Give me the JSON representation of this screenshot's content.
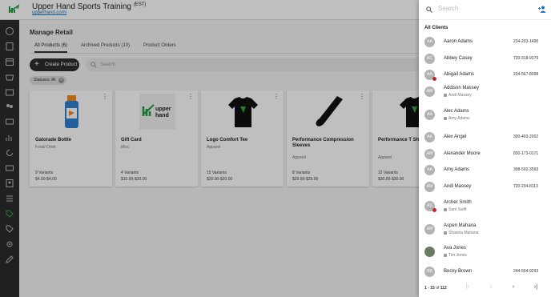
{
  "header": {
    "business_name": "Upper Hand Sports Training",
    "timezone": "(EST)",
    "url": "upperhand.com/"
  },
  "sidebar": {
    "icons": [
      "dashboard-icon",
      "book-icon",
      "calendar-icon",
      "store-icon",
      "wallet-icon",
      "people-icon",
      "chat-icon",
      "report-icon",
      "refresh-icon",
      "ticket-icon",
      "contacts-icon",
      "list-icon",
      "tag-icon",
      "discount-icon",
      "settings-icon",
      "edit-icon"
    ]
  },
  "main": {
    "title": "Manage Retail",
    "tabs": [
      {
        "label": "All Products (6)"
      },
      {
        "label": "Archived Products (10)"
      },
      {
        "label": "Product Orders"
      }
    ],
    "create_label": "Create Product",
    "search_placeholder": "Search",
    "filter_chip": "Statuses: All",
    "products": [
      {
        "name": "Gatorade Bottle",
        "category": "Food/ Drink",
        "variants": "9 Variants",
        "price": "$4.00-$4.00"
      },
      {
        "name": "Gift Card",
        "category": "Misc",
        "variants": "4 Variants",
        "price": "$10.00-$30.00"
      },
      {
        "name": "Logo Comfort Tee",
        "category": "Apparel",
        "variants": "15 Variants",
        "price": "$20.00-$20.00"
      },
      {
        "name": "Performance Compression Sleeves",
        "category": "Apparel",
        "variants": "8 Variants",
        "price": "$29.99-$29.99"
      },
      {
        "name": "Performance T Sh Sleeve",
        "category": "Apparel",
        "variants": "12 Variants",
        "price": "$30.00-$30.00"
      }
    ],
    "gift_card_logo_text": "upper hand"
  },
  "drawer": {
    "search_placeholder": "Search",
    "heading": "All Clients",
    "clients": [
      {
        "initials": "AA",
        "name": "Aaron Adams",
        "phone": "234-203-1490"
      },
      {
        "initials": "AC",
        "name": "Abbey Casey",
        "phone": "720-318-9379"
      },
      {
        "initials": "AA",
        "name": "Abigail Adams",
        "phone": "234-567-8098",
        "alert": true
      },
      {
        "initials": "AM",
        "name": "Addison Massey",
        "phone": "",
        "managed_by": "Andi Massey"
      },
      {
        "initials": "AA",
        "name": "Alec Adams",
        "phone": "",
        "managed_by": "Amy Adams"
      },
      {
        "initials": "AA",
        "name": "Alex Angel",
        "phone": "390-493-2002"
      },
      {
        "initials": "AM",
        "name": "Alexander Moore",
        "phone": "830-173-0171"
      },
      {
        "initials": "AA",
        "name": "Amy Adams",
        "phone": "398-592-3593"
      },
      {
        "initials": "AM",
        "name": "Andi Massey",
        "phone": "720-234-8113"
      },
      {
        "initials": "AS",
        "name": "Archer Smith",
        "phone": "",
        "managed_by": "Sam Swift",
        "alert": true
      },
      {
        "initials": "AM",
        "name": "Aspen Mahana",
        "phone": "",
        "managed_by": "Shawna Mahana"
      },
      {
        "initials": "",
        "name": "Ava Jones",
        "phone": "",
        "managed_by": "Tim Jones",
        "photo": true
      },
      {
        "initials": "BB",
        "name": "Becky Brown",
        "phone": "244-564-9293"
      }
    ],
    "pagination": {
      "range": "1 - 15",
      "of": "of",
      "total": "112"
    }
  }
}
